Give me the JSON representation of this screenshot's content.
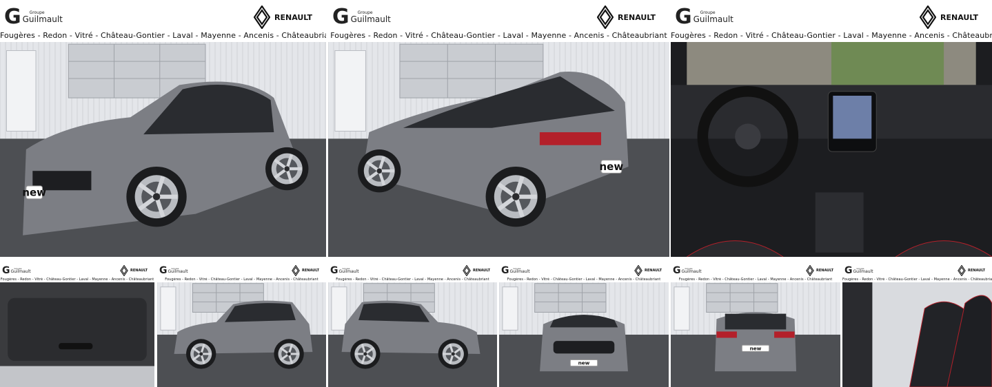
{
  "header": {
    "group_small": "Groupe",
    "group_name": "Guilmault",
    "brand": "RENAULT",
    "towns": "Fougères - Redon - Vitré - Château-Gontier - Laval - Mayenne - Ancenis - Châteaubriant"
  },
  "badge": "new",
  "colors": {
    "car_body": "#7c7e84",
    "car_roof": "#2a2c30",
    "building": "#e4e6ea",
    "asphalt": "#4d4f53",
    "interior": "#1c1d20",
    "accent_red": "#b3202a"
  },
  "photos": [
    {
      "view": "front-three-quarter"
    },
    {
      "view": "rear-three-quarter"
    },
    {
      "view": "dashboard"
    },
    {
      "view": "trunk"
    },
    {
      "view": "side-left"
    },
    {
      "view": "side-right"
    },
    {
      "view": "front"
    },
    {
      "view": "rear"
    },
    {
      "view": "front-seats"
    }
  ]
}
